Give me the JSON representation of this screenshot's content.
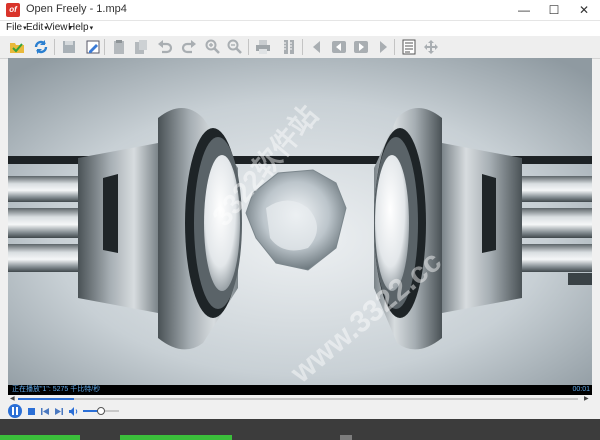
{
  "window": {
    "app_icon_label": "of",
    "title": "Open Freely - 1.mp4",
    "min_glyph": "—",
    "max_glyph": "☐",
    "close_glyph": "✕"
  },
  "menu": [
    {
      "label": "File"
    },
    {
      "label": "Edit"
    },
    {
      "label": "View"
    },
    {
      "label": "Help"
    }
  ],
  "toolbar": {
    "icons": [
      "open-folder-icon",
      "refresh-icon",
      "save-icon",
      "edit-icon",
      "clipboard-icon",
      "paste-icon",
      "undo-icon",
      "redo-icon",
      "zoom-in-icon",
      "zoom-out-icon",
      "print-icon",
      "ruler-icon",
      "previous-icon",
      "back-icon",
      "forward-icon",
      "next-icon",
      "page-layout-icon",
      "move-icon"
    ]
  },
  "video": {
    "watermark_cn": "3322软件站",
    "watermark_url": "www.3322.cc"
  },
  "status": {
    "buffer_text": "正在播放\"1\": 5275 千比特/秒",
    "time": "00:01"
  },
  "playback": {
    "seek_progress": 0.1,
    "volume_level": 0.5
  },
  "colors": {
    "accent": "#2b6fd6",
    "status_text": "#5fa8e8",
    "brand_red": "#d9342b"
  }
}
